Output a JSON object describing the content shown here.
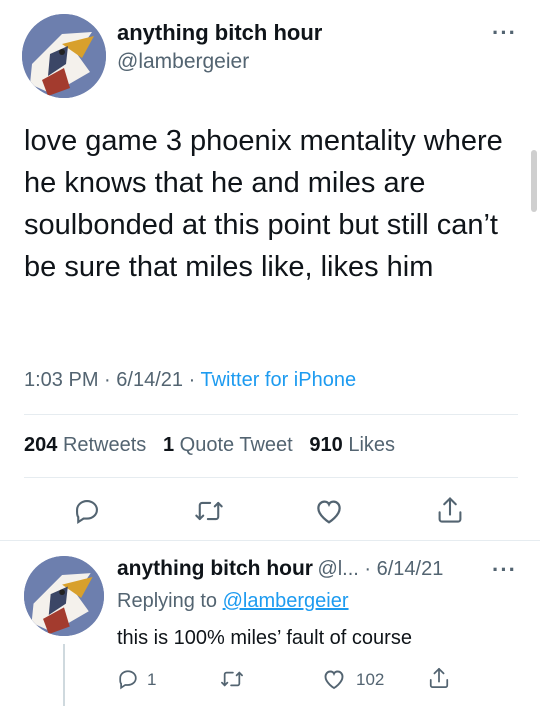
{
  "tweet": {
    "author_name": "anything bitch hour",
    "author_handle": "@lambergeier",
    "text": "love game 3 phoenix mentality where he knows that he and miles are soulbonded at this point but still can’t be sure that miles like, likes him",
    "time": "1:03 PM",
    "date": "6/14/21",
    "client": "Twitter for iPhone",
    "separator": "·",
    "more_label": "···"
  },
  "stats": {
    "retweets_count": "204",
    "retweets_label": "Retweets",
    "quotes_count": "1",
    "quotes_label": "Quote Tweet",
    "likes_count": "910",
    "likes_label": "Likes"
  },
  "reply": {
    "author_name": "anything bitch hour",
    "author_handle_date": "@l... · 6/14/21",
    "replying_prefix": "Replying to",
    "replying_handle": "@lambergeier",
    "text": "this is 100% miles’ fault of course",
    "reply_count": "1",
    "like_count": "102",
    "more_label": "···"
  },
  "icons": {
    "reply": "reply-icon",
    "retweet": "retweet-icon",
    "like": "heart-icon",
    "share": "share-icon"
  },
  "colors": {
    "link": "#1d9bf0",
    "secondary_text": "#536471",
    "primary_text": "#0f1419"
  }
}
